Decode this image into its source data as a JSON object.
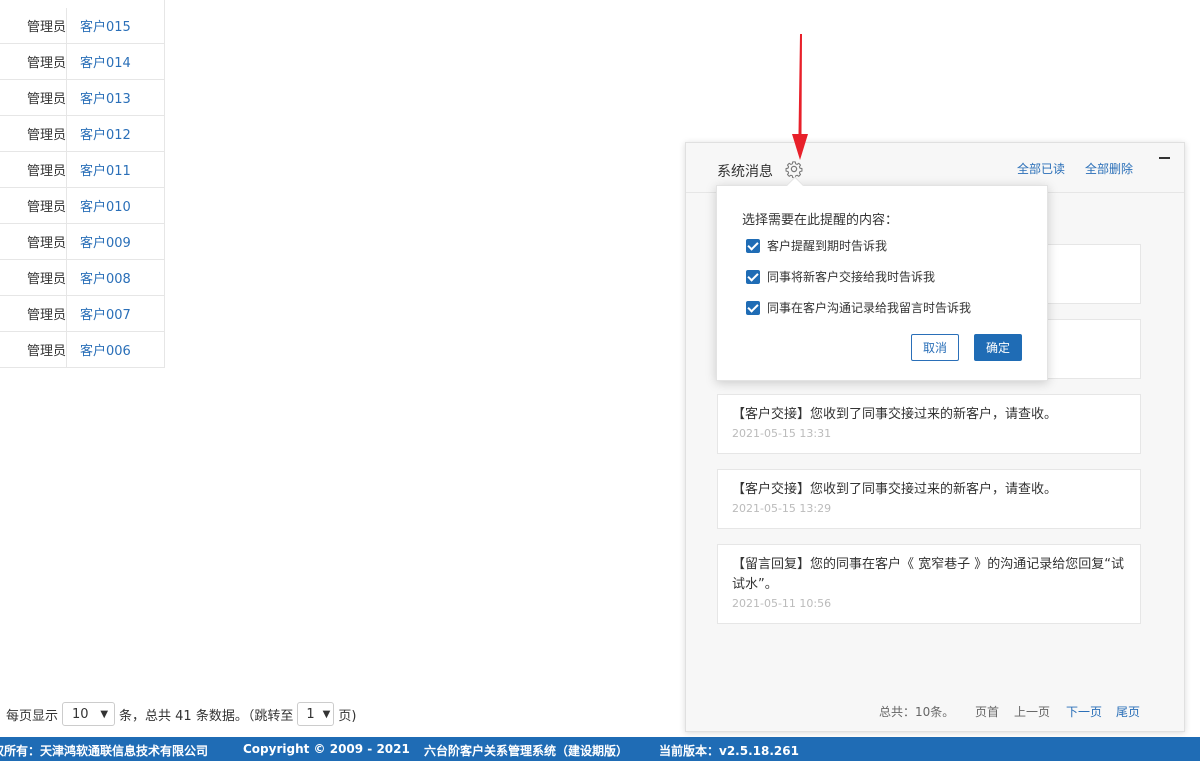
{
  "table": {
    "rows": [
      {
        "owner": "管理员",
        "customer": "客户015"
      },
      {
        "owner": "管理员",
        "customer": "客户014"
      },
      {
        "owner": "管理员",
        "customer": "客户013"
      },
      {
        "owner": "管理员",
        "customer": "客户012"
      },
      {
        "owner": "管理员",
        "customer": "客户011"
      },
      {
        "owner": "管理员",
        "customer": "客户010"
      },
      {
        "owner": "管理员",
        "customer": "客户009"
      },
      {
        "owner": "管理员",
        "customer": "客户008"
      },
      {
        "owner": "管理员",
        "customer": "客户007"
      },
      {
        "owner": "管理员",
        "customer": "客户006"
      }
    ]
  },
  "pager": {
    "prefix": "每页显示",
    "page_size": "10",
    "middle": "条，总共 41 条数据。（跳转至",
    "page": "1",
    "suffix": "页)"
  },
  "footer": {
    "copyright_owner": "权所有：天津鸿软通联信息技术有限公司",
    "copyright": "Copyright © 2009 - 2021",
    "product": "六台阶客户关系管理系统（建设期版）",
    "version": "当前版本：v2.5.18.261"
  },
  "panel": {
    "title": "系统消息",
    "mark_all_read": "全部已读",
    "delete_all": "全部删除",
    "messages": [
      {
        "text": "【客户交接】您收到了同事交接过来的新客户，请查收。",
        "time": "2021-05-15 13:31"
      },
      {
        "text": "【客户交接】您收到了同事交接过来的新客户，请查收。",
        "time": "2021-05-15 13:29"
      },
      {
        "text": "【留言回复】您的同事在客户《 宽窄巷子 》的沟通记录给您回复“试试水”。",
        "time": "2021-05-11 10:56"
      }
    ],
    "footer": {
      "total": "总共：10条。",
      "first": "页首",
      "prev": "上一页",
      "next": "下一页",
      "last": "尾页"
    }
  },
  "popover": {
    "title": "选择需要在此提醒的内容：",
    "options": [
      {
        "label": "客户提醒到期时告诉我",
        "checked": true
      },
      {
        "label": "同事将新客户交接给我时告诉我",
        "checked": true
      },
      {
        "label": "同事在客户沟通记录给我留言时告诉我",
        "checked": true
      }
    ],
    "cancel": "取消",
    "confirm": "确定"
  },
  "colors": {
    "accent": "#1f6cb5",
    "link": "#2a6fb8",
    "arrow": "#e8202a"
  },
  "icons": [
    "gear-icon",
    "minimize-icon",
    "chevron-down-icon",
    "arrow-annotation"
  ]
}
